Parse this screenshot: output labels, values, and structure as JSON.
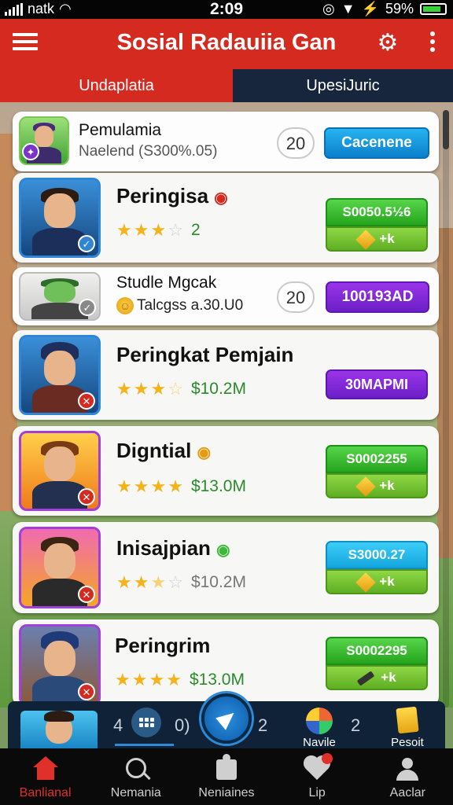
{
  "status_bar": {
    "carrier": "natk",
    "time": "2:09",
    "battery": "59%"
  },
  "header": {
    "title": "Sosial Radauiia Gan",
    "menu_icon": "hamburger-icon",
    "settings_icon": "gear-icon",
    "more_icon": "kebab-icon"
  },
  "tabs": [
    {
      "label": "Undaplatia",
      "active": true
    },
    {
      "label": "UpesiJuric",
      "active": false
    }
  ],
  "list": [
    {
      "name": "Pemulamia",
      "subtitle": "Naelend (S300%.05)",
      "count": "20",
      "button": "Cacenene"
    },
    {
      "name": "Peringisa",
      "rating": 3,
      "value": "2",
      "button_top": "S0050.5½6",
      "button_bottom": "+k"
    },
    {
      "name": "Studle Mgcak",
      "subtitle": "Talcgss a.30.U0",
      "count": "20",
      "button": "100193AD"
    },
    {
      "name": "Peringkat Pemjain",
      "rating": 3,
      "value": "$10.2M",
      "button": "30MAPMI"
    },
    {
      "name": "Digntial",
      "rating": 4,
      "value": "$13.0M",
      "button_top": "S0002255",
      "button_bottom": "+k"
    },
    {
      "name": "Inisajpian",
      "rating": 2.5,
      "value": "$10.2M",
      "button_top": "S3000.27",
      "button_bottom": "+k"
    },
    {
      "name": "Peringrim",
      "rating": 4,
      "value": "$13.0M",
      "button_top": "S0002295",
      "button_bottom": "+k"
    }
  ],
  "bottom_strip": {
    "num_left": "4",
    "num_mid": "0)",
    "num_right": "2",
    "num_far": "2",
    "item1_label": "Navile",
    "item2_label": "Pesoit"
  },
  "bottom_nav": [
    {
      "label": "Banlianal",
      "icon": "home-icon",
      "active": true
    },
    {
      "label": "Nemania",
      "icon": "search-icon",
      "active": false
    },
    {
      "label": "Neniaines",
      "icon": "puzzle-icon",
      "active": false
    },
    {
      "label": "Lip",
      "icon": "heart-icon",
      "active": false
    },
    {
      "label": "Aaclar",
      "icon": "user-icon",
      "active": false
    }
  ]
}
